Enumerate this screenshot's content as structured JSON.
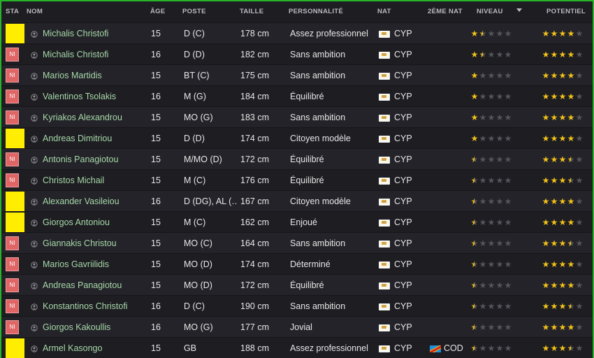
{
  "columns": {
    "sta": "STA",
    "name": "NOM",
    "age": "ÂGE",
    "pos": "POSTE",
    "height": "TAILLE",
    "pers": "PERSONNALITÉ",
    "nat": "NAT",
    "nat2": "2ÈME NAT",
    "ability": "NIVEAU",
    "potential": "POTENTIEL"
  },
  "sort_column": "ability",
  "colors": {
    "border": "#28b428",
    "name": "#a8d8a8",
    "star": "#f2c21a",
    "status_yellow": "#ffee00",
    "status_ni": "#e06666"
  },
  "players": [
    {
      "status": "yellow",
      "status_label": "",
      "name": "Michalis Christofi",
      "age": "15",
      "pos": "D (C)",
      "height": "178 cm",
      "pers": "Assez professionnel",
      "nat": "CYP",
      "nat2": "",
      "ability": 1.5,
      "potential": 4
    },
    {
      "status": "ni",
      "status_label": "NI",
      "name": "Michalis Christofi",
      "age": "16",
      "pos": "D (D)",
      "height": "182 cm",
      "pers": "Sans ambition",
      "nat": "CYP",
      "nat2": "",
      "ability": 1.5,
      "potential": 4
    },
    {
      "status": "ni",
      "status_label": "NI",
      "name": "Marios Martidis",
      "age": "15",
      "pos": "BT (C)",
      "height": "175 cm",
      "pers": "Sans ambition",
      "nat": "CYP",
      "nat2": "",
      "ability": 1,
      "potential": 4
    },
    {
      "status": "ni",
      "status_label": "NI",
      "name": "Valentinos Tsolakis",
      "age": "16",
      "pos": "M (G)",
      "height": "184 cm",
      "pers": "Équilibré",
      "nat": "CYP",
      "nat2": "",
      "ability": 1,
      "potential": 4
    },
    {
      "status": "ni",
      "status_label": "NI",
      "name": "Kyriakos Alexandrou",
      "age": "15",
      "pos": "MO (G)",
      "height": "183 cm",
      "pers": "Sans ambition",
      "nat": "CYP",
      "nat2": "",
      "ability": 1,
      "potential": 4
    },
    {
      "status": "yellow",
      "status_label": "",
      "name": "Andreas Dimitriou",
      "age": "15",
      "pos": "D (D)",
      "height": "174 cm",
      "pers": "Citoyen modèle",
      "nat": "CYP",
      "nat2": "",
      "ability": 1,
      "potential": 4
    },
    {
      "status": "ni",
      "status_label": "NI",
      "name": "Antonis Panagiotou",
      "age": "15",
      "pos": "M/MO (D)",
      "height": "172 cm",
      "pers": "Équilibré",
      "nat": "CYP",
      "nat2": "",
      "ability": 0.5,
      "potential": 3.5
    },
    {
      "status": "ni",
      "status_label": "NI",
      "name": "Christos Michail",
      "age": "15",
      "pos": "M (C)",
      "height": "176 cm",
      "pers": "Équilibré",
      "nat": "CYP",
      "nat2": "",
      "ability": 0.5,
      "potential": 3.5
    },
    {
      "status": "yellow",
      "status_label": "",
      "name": "Alexander Vasileiou",
      "age": "16",
      "pos": "D (DG), AL (…",
      "height": "167 cm",
      "pers": "Citoyen modèle",
      "nat": "CYP",
      "nat2": "",
      "ability": 0.5,
      "potential": 4
    },
    {
      "status": "yellow",
      "status_label": "",
      "name": "Giorgos Antoniou",
      "age": "15",
      "pos": "M (C)",
      "height": "162 cm",
      "pers": "Enjoué",
      "nat": "CYP",
      "nat2": "",
      "ability": 0.5,
      "potential": 4
    },
    {
      "status": "ni",
      "status_label": "NI",
      "name": "Giannakis Christou",
      "age": "15",
      "pos": "MO (C)",
      "height": "164 cm",
      "pers": "Sans ambition",
      "nat": "CYP",
      "nat2": "",
      "ability": 0.5,
      "potential": 3.5
    },
    {
      "status": "ni",
      "status_label": "NI",
      "name": "Marios Gavriilidis",
      "age": "15",
      "pos": "MO (D)",
      "height": "174 cm",
      "pers": "Déterminé",
      "nat": "CYP",
      "nat2": "",
      "ability": 0.5,
      "potential": 4
    },
    {
      "status": "ni",
      "status_label": "NI",
      "name": "Andreas Panagiotou",
      "age": "15",
      "pos": "MO (D)",
      "height": "172 cm",
      "pers": "Équilibré",
      "nat": "CYP",
      "nat2": "",
      "ability": 0.5,
      "potential": 4
    },
    {
      "status": "ni",
      "status_label": "NI",
      "name": "Konstantinos Christofi",
      "age": "16",
      "pos": "D (C)",
      "height": "190 cm",
      "pers": "Sans ambition",
      "nat": "CYP",
      "nat2": "",
      "ability": 0.5,
      "potential": 3.5
    },
    {
      "status": "ni",
      "status_label": "NI",
      "name": "Giorgos Kakoullis",
      "age": "16",
      "pos": "MO (G)",
      "height": "177 cm",
      "pers": "Jovial",
      "nat": "CYP",
      "nat2": "",
      "ability": 0.5,
      "potential": 4
    },
    {
      "status": "yellow",
      "status_label": "",
      "name": "Armel Kasongo",
      "age": "15",
      "pos": "GB",
      "height": "188 cm",
      "pers": "Assez professionnel",
      "nat": "CYP",
      "nat2": "COD",
      "ability": 0.5,
      "potential": 3.5
    }
  ]
}
